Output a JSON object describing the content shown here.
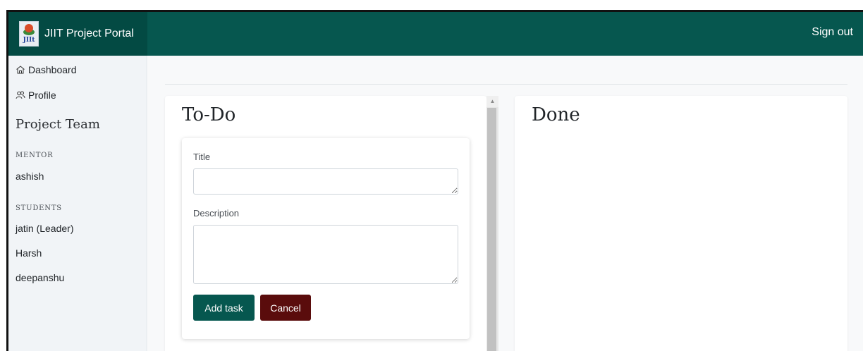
{
  "header": {
    "brand_name": "JIIT Project Portal",
    "logo_text": "JIIt",
    "sign_out": "Sign out",
    "colors": {
      "header": "#06574f",
      "brand": "#034a43"
    }
  },
  "sidebar": {
    "nav": [
      {
        "label": "Dashboard",
        "icon": "home-icon"
      },
      {
        "label": "Profile",
        "icon": "users-icon"
      }
    ],
    "team_title": "Project Team",
    "mentor_label": "MENTOR",
    "mentor": "ashish",
    "students_label": "STUDENTS",
    "students": [
      "jatin (Leader)",
      "Harsh",
      "deepanshu"
    ]
  },
  "todo": {
    "title": "To-Do",
    "form": {
      "title_label": "Title",
      "title_value": "",
      "description_label": "Description",
      "description_value": "",
      "add_button": "Add task",
      "cancel_button": "Cancel"
    },
    "colors": {
      "add": "#06574f",
      "cancel": "#5a0c0c"
    }
  },
  "done": {
    "title": "Done"
  }
}
